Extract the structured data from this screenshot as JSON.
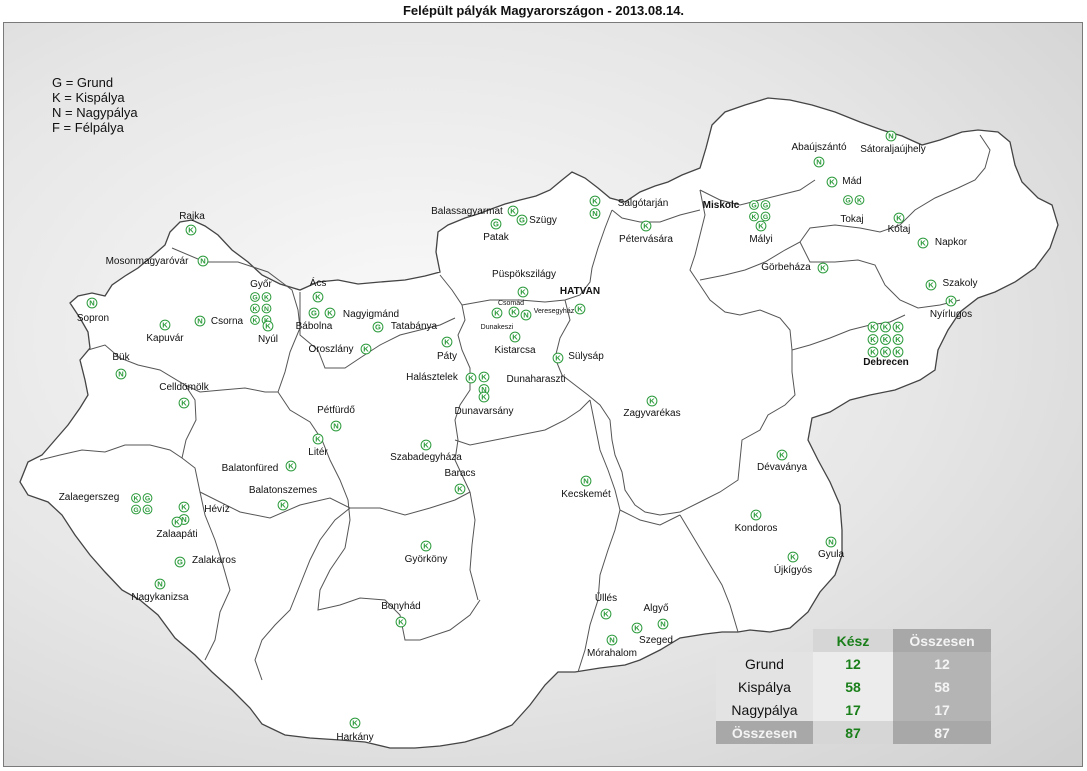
{
  "title": "Felépült pályák Magyarországon - 2013.08.14.",
  "legend": [
    "G = Grund",
    "K = Kispálya",
    "N = Nagypálya",
    "F = Félpálya"
  ],
  "colors": {
    "marker": "#2a9a3a",
    "kesz": "#1a7f1a",
    "border": "#555555"
  },
  "places": [
    {
      "name": "Rajka",
      "codes": [
        "K"
      ]
    },
    {
      "name": "Mosonmagyaróvár",
      "codes": [
        "N"
      ]
    },
    {
      "name": "Sopron",
      "codes": [
        "N"
      ]
    },
    {
      "name": "Győr",
      "codes": [
        "G",
        "K",
        "K",
        "N",
        "K",
        "K"
      ]
    },
    {
      "name": "Kapuvár",
      "codes": [
        "K"
      ]
    },
    {
      "name": "Csorna",
      "codes": [
        "N"
      ]
    },
    {
      "name": "Nyúl",
      "codes": [
        "K"
      ]
    },
    {
      "name": "Ács",
      "codes": [
        "K"
      ]
    },
    {
      "name": "Bábolna",
      "codes": [
        "G"
      ]
    },
    {
      "name": "Nagyigmánd",
      "codes": [
        "K"
      ]
    },
    {
      "name": "Tatabánya",
      "codes": [
        "G"
      ]
    },
    {
      "name": "Oroszlány",
      "codes": [
        "K"
      ]
    },
    {
      "name": "Bük",
      "codes": [
        "N"
      ]
    },
    {
      "name": "Celldömölk",
      "codes": [
        "K"
      ]
    },
    {
      "name": "Pétfürdő",
      "codes": [
        "N"
      ]
    },
    {
      "name": "Litér",
      "codes": [
        "K"
      ]
    },
    {
      "name": "Balatonfüred",
      "codes": [
        "K"
      ]
    },
    {
      "name": "Balatonszemes",
      "codes": [
        "K"
      ]
    },
    {
      "name": "Zalaegerszeg",
      "codes": [
        "K",
        "G",
        "G",
        "G"
      ]
    },
    {
      "name": "Hévíz",
      "codes": [
        "K",
        "N"
      ]
    },
    {
      "name": "Zalaapáti",
      "codes": [
        "K"
      ]
    },
    {
      "name": "Zalakaros",
      "codes": [
        "G"
      ]
    },
    {
      "name": "Nagykanizsa",
      "codes": [
        "N"
      ]
    },
    {
      "name": "Szabadegyháza",
      "codes": [
        "K"
      ]
    },
    {
      "name": "Baracs",
      "codes": [
        "K"
      ]
    },
    {
      "name": "Györköny",
      "codes": [
        "K"
      ]
    },
    {
      "name": "Bonyhád",
      "codes": [
        "K"
      ]
    },
    {
      "name": "Harkány",
      "codes": [
        "K"
      ]
    },
    {
      "name": "Balassagyarmat",
      "codes": [
        "K"
      ]
    },
    {
      "name": "Szügy",
      "codes": [
        "G"
      ]
    },
    {
      "name": "Patak",
      "codes": [
        "G"
      ]
    },
    {
      "name": "Salgótarján",
      "codes": [
        "K",
        "N"
      ]
    },
    {
      "name": "Pétervására",
      "codes": [
        "K"
      ]
    },
    {
      "name": "Püspökszilágy",
      "codes": [
        "K"
      ]
    },
    {
      "name": "Csomád",
      "codes": [
        "K"
      ]
    },
    {
      "name": "Veresegyház",
      "codes": [
        "N"
      ]
    },
    {
      "name": "Dunakeszi",
      "codes": [
        "K"
      ]
    },
    {
      "name": "HATVAN",
      "codes": [
        "K"
      ]
    },
    {
      "name": "Kistarcsa",
      "codes": [
        "K"
      ]
    },
    {
      "name": "Sülysáp",
      "codes": [
        "K"
      ]
    },
    {
      "name": "Páty",
      "codes": [
        "K"
      ]
    },
    {
      "name": "Halásztelek",
      "codes": [
        "K"
      ]
    },
    {
      "name": "Dunaharaszti",
      "codes": [
        "K",
        "N"
      ]
    },
    {
      "name": "Dunavarsány",
      "codes": [
        "K"
      ]
    },
    {
      "name": "Zagyvarékas",
      "codes": [
        "K"
      ]
    },
    {
      "name": "Kecskemét",
      "codes": [
        "N"
      ]
    },
    {
      "name": "Üllés",
      "codes": [
        "K"
      ]
    },
    {
      "name": "Algyő",
      "codes": [
        "N"
      ]
    },
    {
      "name": "Szeged",
      "codes": [
        "K"
      ]
    },
    {
      "name": "Mórahalom",
      "codes": [
        "N"
      ]
    },
    {
      "name": "Miskolc",
      "codes": [
        "G",
        "G",
        "K",
        "G"
      ]
    },
    {
      "name": "Mályi",
      "codes": [
        "K"
      ]
    },
    {
      "name": "Abaújszántó",
      "codes": [
        "N"
      ]
    },
    {
      "name": "Sátoraljaújhely",
      "codes": [
        "N"
      ]
    },
    {
      "name": "Mád",
      "codes": [
        "K"
      ]
    },
    {
      "name": "Tokaj",
      "codes": [
        "G",
        "K"
      ]
    },
    {
      "name": "Kótaj",
      "codes": [
        "K"
      ]
    },
    {
      "name": "Napkor",
      "codes": [
        "K"
      ]
    },
    {
      "name": "Görbeháza",
      "codes": [
        "K"
      ]
    },
    {
      "name": "Szakoly",
      "codes": [
        "K"
      ]
    },
    {
      "name": "Nyírlugos",
      "codes": [
        "K"
      ]
    },
    {
      "name": "Debrecen",
      "codes": [
        "K",
        "K",
        "K",
        "K",
        "K",
        "K",
        "K",
        "K",
        "K"
      ]
    },
    {
      "name": "Dévaványa",
      "codes": [
        "K"
      ]
    },
    {
      "name": "Kondoros",
      "codes": [
        "K"
      ]
    },
    {
      "name": "Gyula",
      "codes": [
        "N"
      ]
    },
    {
      "name": "Újkígyós",
      "codes": [
        "K"
      ]
    }
  ],
  "stats": {
    "headers": [
      "",
      "Kész",
      "Összesen"
    ],
    "rows": [
      {
        "label": "Grund",
        "kesz": "12",
        "osszesen": "12"
      },
      {
        "label": "Kispálya",
        "kesz": "58",
        "osszesen": "58"
      },
      {
        "label": "Nagypálya",
        "kesz": "17",
        "osszesen": "17"
      }
    ],
    "total": {
      "label": "Összesen",
      "kesz": "87",
      "osszesen": "87"
    }
  }
}
